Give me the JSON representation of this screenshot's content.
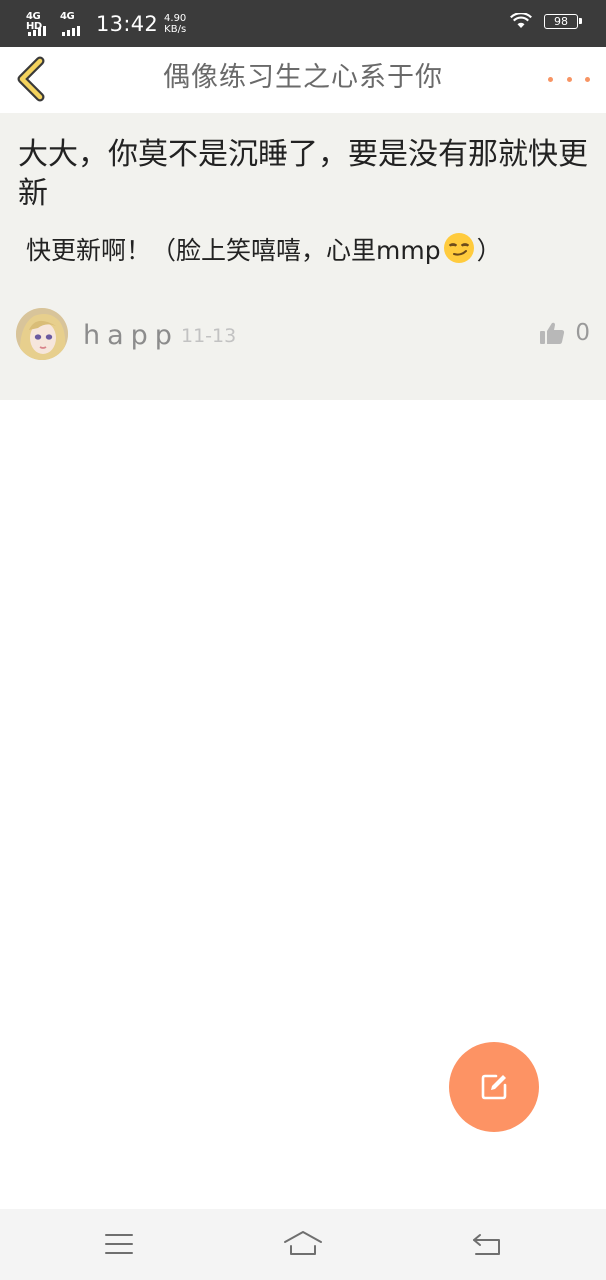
{
  "status_bar": {
    "network_1": "4G HD",
    "network_2": "4G",
    "time": "13:42",
    "speed_value": "4.90",
    "speed_unit": "KB/s",
    "battery": "98",
    "icons": [
      "signal-icon",
      "wifi-icon",
      "battery-icon"
    ]
  },
  "header": {
    "title": "偶像练习生之心系于你",
    "back_icon": "chevron-left-icon",
    "more_icon": "more-dots-icon",
    "accent_color": "#f79463"
  },
  "post": {
    "title": "大大，你莫不是沉睡了，要是没有那就快更新",
    "body_before_emoji": "快更新啊！（脸上笑嘻嘻，心里mmp",
    "body_after_emoji": "）",
    "emoji": "smirking-face-emoji",
    "author": "happ",
    "date": "11-13",
    "like_count": "0",
    "like_icon": "thumbs-up-icon",
    "background": "#f2f2ee"
  },
  "fab": {
    "icon": "edit-icon",
    "color": "#fd9364"
  },
  "nav_bar": {
    "icons": [
      "menu-icon",
      "home-icon",
      "back-icon"
    ]
  }
}
